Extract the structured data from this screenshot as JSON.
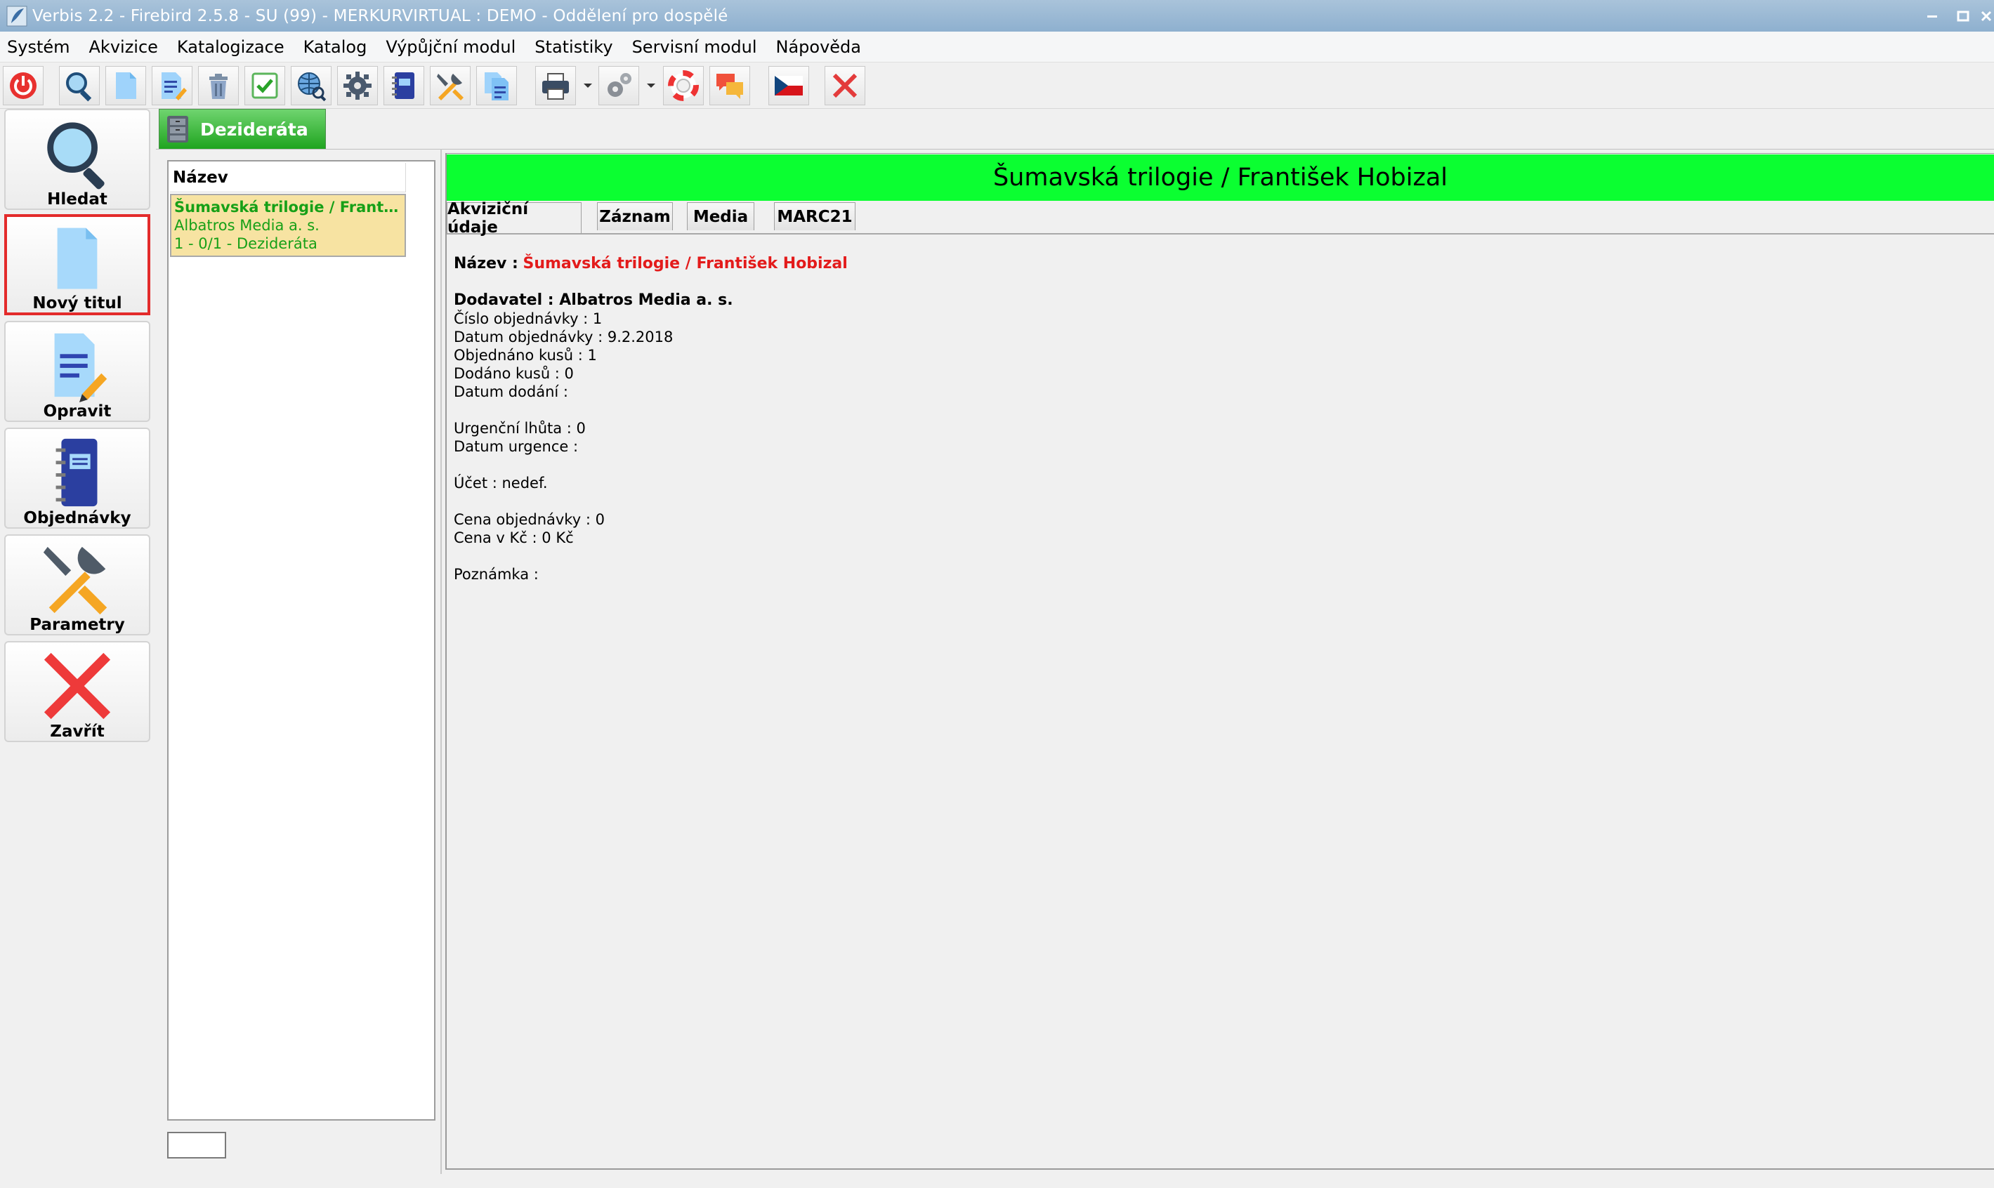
{
  "window": {
    "title": "Verbis 2.2 - Firebird 2.5.8 - SU (99) - MERKURVIRTUAL : DEMO - Oddělení pro dospělé",
    "icon": "app-feather-icon",
    "buttons": [
      "minimize-icon",
      "maximize-icon",
      "close-icon"
    ]
  },
  "menu": {
    "items": [
      "Systém",
      "Akvizice",
      "Katalogizace",
      "Katalog",
      "Výpůjční modul",
      "Statistiky",
      "Servisní modul",
      "Nápověda"
    ]
  },
  "toolbar": {
    "buttons": [
      "power-icon",
      "search-icon",
      "new-document-icon",
      "edit-document-icon",
      "trash-icon",
      "checkmark-icon",
      "web-search-icon",
      "settings-gear-icon",
      "notebook-icon",
      "tools-icon",
      "copy-document-icon",
      "printer-icon",
      "settings-cogs-icon",
      "lifebuoy-icon",
      "chat-icon",
      "czech-flag-icon",
      "close-x-icon"
    ]
  },
  "sidebar": {
    "items": [
      {
        "label": "Hledat",
        "icon": "magnifier-icon"
      },
      {
        "label": "Nový titul",
        "icon": "new-document-icon",
        "selected": true
      },
      {
        "label": "Opravit",
        "icon": "edit-document-icon"
      },
      {
        "label": "Objednávky",
        "icon": "notebook-icon"
      },
      {
        "label": "Parametry",
        "icon": "tools-icon"
      },
      {
        "label": "Zavřít",
        "icon": "close-x-icon"
      }
    ]
  },
  "section_tab": {
    "label": "Dezideráta",
    "icon": "cabinet-icon"
  },
  "list": {
    "header": "Název",
    "items": [
      {
        "title": "Šumavská trilogie / Františ...",
        "supplier": "Albatros Media a. s.",
        "status": "1 - 0/1 - Dezideráta"
      }
    ],
    "search_value": ""
  },
  "detail": {
    "header": "Šumavská trilogie / František Hobizal",
    "tabs": [
      "Akviziční údaje",
      "Záznam",
      "Media",
      "MARC21"
    ],
    "active_tab": "Akviziční údaje",
    "title_label": "Název :",
    "title_value": "Šumavská trilogie / František Hobizal",
    "supplier_line": "Dodavatel : Albatros Media a. s.",
    "order_number": "Číslo objednávky : 1",
    "order_date": "Datum objednávky : 9.2.2018",
    "ordered_qty": "Objednáno kusů : 1",
    "delivered_qty": "Dodáno kusů : 0",
    "delivery_date": "Datum dodání :",
    "urgency_period": "Urgenční lhůta : 0",
    "urgency_date": "Datum urgence :",
    "account": "Účet : nedef.",
    "order_price": "Cena objednávky : 0",
    "price_czk": "Cena v Kč : 0 Kč",
    "note": "Poznámka :"
  },
  "colors": {
    "header_green": "#0bff31",
    "tab_green": "#1fa41f",
    "list_item_bg": "#f7e3a2",
    "list_item_text": "#17a017",
    "title_red": "#e31b1b",
    "selected_border": "#e32b2b"
  }
}
